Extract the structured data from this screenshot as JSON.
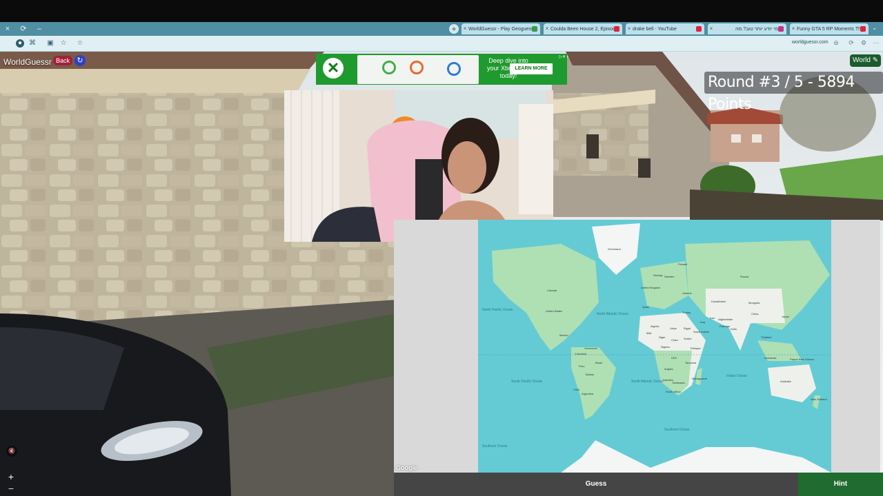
{
  "browser": {
    "tabs": [
      {
        "title": "WorldGuessr - Play Geoguessr",
        "favicon_color": "#3c9a4a"
      },
      {
        "title": "Coulda Been House 2, Episode",
        "favicon_color": "#e0213d"
      },
      {
        "title": "drake bell - YouTube",
        "favicon_color": "#e0213d"
      },
      {
        "title": "מי יודע יותר טוב? מה",
        "favicon_color": "#c13584"
      },
      {
        "title": "Funny GTA 5 RP Moments That",
        "favicon_color": "#e0213d"
      }
    ],
    "url": "worldguessr.com",
    "icons": {
      "close": "×",
      "refresh": "⟳",
      "minimize": "–",
      "new_tab": "+",
      "tab_menu": "⌄",
      "star": "☆",
      "back": "⇦"
    }
  },
  "game": {
    "logo": "WorldGuessr",
    "back_label": "Back",
    "refresh_icon": "↻",
    "mode_label": "World ✎",
    "round_info": "Round #3 / 5 - 5894 Points",
    "guess_label": "Guess",
    "hint_label": "Hint",
    "zoom_in": "+",
    "zoom_out": "−",
    "sound_icon": "🔇"
  },
  "ad": {
    "text": "Deep dive into your Xbox stats today!",
    "cta": "LEARN MORE",
    "logo_icon": "xbox-logo",
    "adchoices": "▷✕"
  },
  "map": {
    "attribution": "Google",
    "ocean_labels": [
      {
        "name": "North Atlantic Ocean"
      },
      {
        "name": "North Pacific Ocean"
      },
      {
        "name": "South Pacific Ocean"
      },
      {
        "name": "South Atlantic Ocean"
      },
      {
        "name": "Indian Ocean"
      },
      {
        "name": "Southern Ocean"
      },
      {
        "name": "Southern Ocean"
      }
    ],
    "country_labels": [
      "Greenland",
      "Canada",
      "United States",
      "Mexico",
      "Venezuela",
      "Colombia",
      "Brazil",
      "Peru",
      "Bolivia",
      "Argentina",
      "Chile",
      "Russia",
      "Kazakhstan",
      "Mongolia",
      "China",
      "India",
      "Iran",
      "Algeria",
      "Libya",
      "Egypt",
      "Niger",
      "Chad",
      "Sudan",
      "Nigeria",
      "Ethiopia",
      "DRC",
      "Angola",
      "Tanzania",
      "Namibia",
      "Botswana",
      "South Africa",
      "Madagascar",
      "Australia",
      "Papua New Guinea",
      "Indonesia",
      "New Zealand",
      "Saudi Arabia",
      "Turkey",
      "Japan",
      "Finland",
      "Sweden",
      "Norway",
      "United Kingdom",
      "Ukraine",
      "Spain",
      "Iraq",
      "Afghanistan",
      "Pakistan",
      "Mali",
      "Thailand"
    ]
  }
}
